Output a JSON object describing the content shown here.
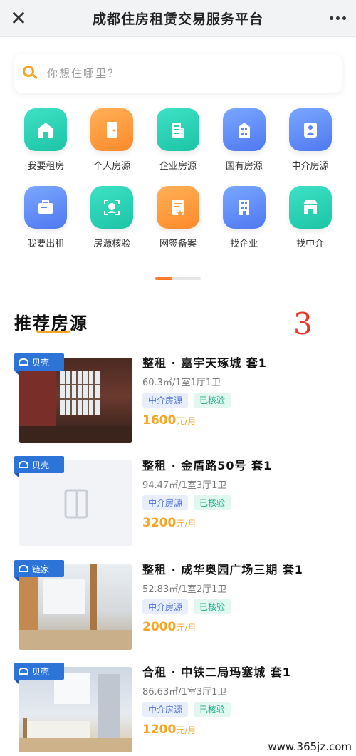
{
  "header": {
    "title": "成都住房租赁交易服务平台"
  },
  "search": {
    "placeholder": "你想住哪里？"
  },
  "services": [
    {
      "label": "我要租房",
      "color": "green",
      "icon": "house-icon"
    },
    {
      "label": "个人房源",
      "color": "orange",
      "icon": "door-icon"
    },
    {
      "label": "企业房源",
      "color": "green",
      "icon": "building-icon"
    },
    {
      "label": "国有房源",
      "color": "blue",
      "icon": "state-building-icon"
    },
    {
      "label": "中介房源",
      "color": "blue",
      "icon": "agent-icon"
    },
    {
      "label": "我要出租",
      "color": "blue",
      "icon": "rent-out-icon"
    },
    {
      "label": "房源核验",
      "color": "green",
      "icon": "verify-face-icon"
    },
    {
      "label": "网签备案",
      "color": "orange",
      "icon": "contract-icon"
    },
    {
      "label": "找企业",
      "color": "blue",
      "icon": "company-icon"
    },
    {
      "label": "找中介",
      "color": "green",
      "icon": "shop-icon"
    }
  ],
  "pager": {
    "active_fraction": 0.375
  },
  "section": {
    "title": "推荐房源",
    "annotation": "3"
  },
  "listings": [
    {
      "badge": "贝壳",
      "name": "整租 · 嘉宇天琢城 套1",
      "spec": "60.3㎡/1室1厅1卫",
      "tag1": "中介房源",
      "tag2": "已核验",
      "price": "1600",
      "unit": "元/月"
    },
    {
      "badge": "贝壳",
      "name": "整租 · 金盾路50号 套1",
      "spec": "94.47㎡/1室3厅1卫",
      "tag1": "中介房源",
      "tag2": "已核验",
      "price": "3200",
      "unit": "元/月"
    },
    {
      "badge": "链家",
      "name": "整租 · 成华奥园广场三期 套1",
      "spec": "52.83㎡/1室2厅1卫",
      "tag1": "中介房源",
      "tag2": "已核验",
      "price": "2000",
      "unit": "元/月"
    },
    {
      "badge": "贝壳",
      "name": "合租 · 中铁二局玛塞城 套1",
      "spec": "86.63㎡/1室3厅1卫",
      "tag1": "中介房源",
      "tag2": "已核验",
      "price": "1200",
      "unit": "元/月"
    }
  ],
  "watermark": "www.365jz.com"
}
